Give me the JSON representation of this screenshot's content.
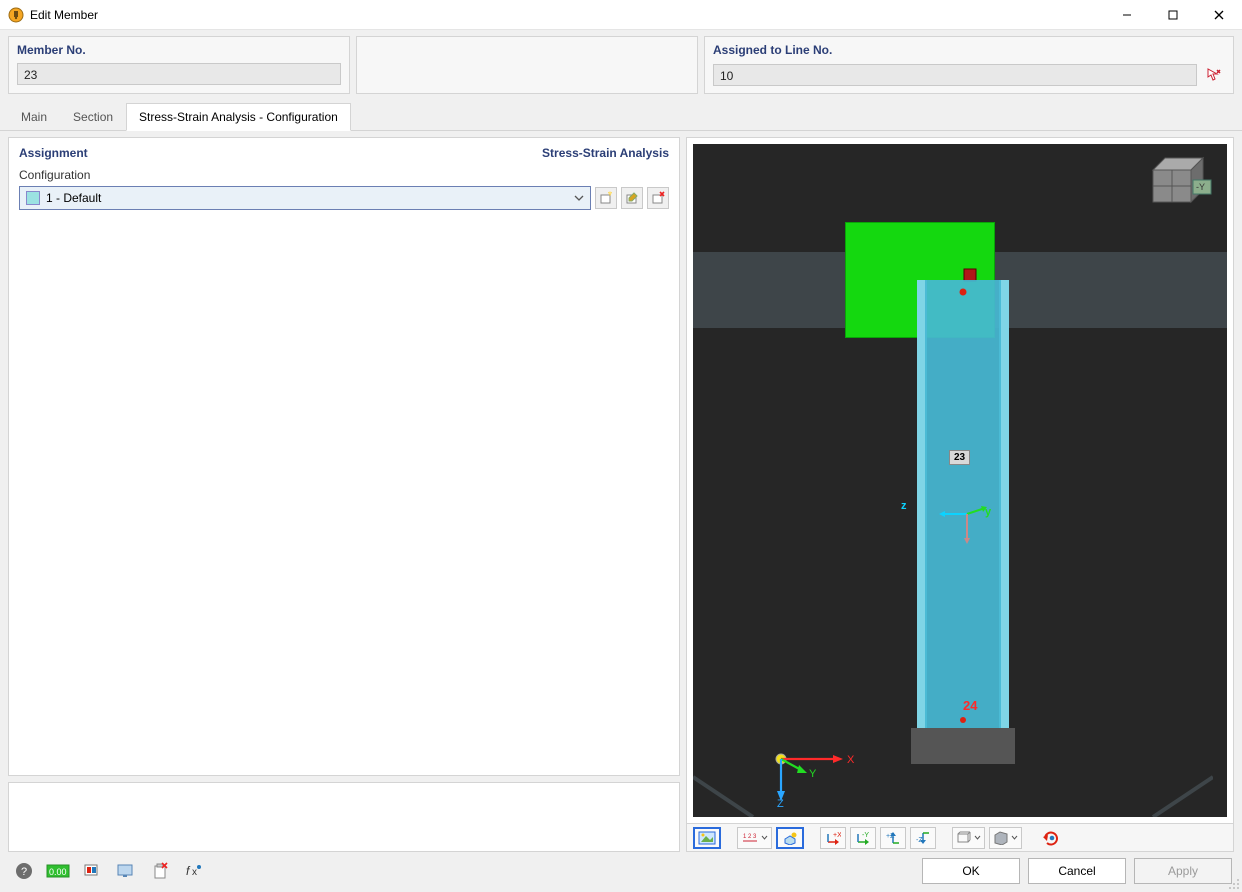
{
  "window": {
    "title": "Edit Member"
  },
  "info": {
    "member_label": "Member No.",
    "member_value": "23",
    "assigned_label": "Assigned to Line No.",
    "assigned_value": "10"
  },
  "tabs": [
    {
      "label": "Main"
    },
    {
      "label": "Section"
    },
    {
      "label": "Stress-Strain Analysis - Configuration"
    }
  ],
  "assignment": {
    "panel_title": "Assignment",
    "panel_title_right": "Stress-Strain Analysis",
    "config_label": "Configuration",
    "config_value": "1 - Default"
  },
  "view3d": {
    "member_badge": "23",
    "node_badge": "24",
    "axis_z": "z",
    "axis_y": "y",
    "ucs": {
      "x": "X",
      "y": "Y",
      "z": "Z"
    },
    "cube_y": "-Y"
  },
  "view_toolbar": {
    "btn_image": "image-view-icon",
    "btn_values": "show-values-icon",
    "btn_iso": "isometric-view-icon",
    "btn_x": "+X",
    "btn_y": "-Y",
    "btn_z_up": "+Z",
    "btn_z_dn": "-Z",
    "btn_wire": "wireframe-icon",
    "btn_solid": "solid-icon",
    "btn_reset": "reset-view-icon"
  },
  "bottom_tools": {
    "help": "help-icon",
    "units": "0.00",
    "display": "display-settings-icon",
    "screen": "screen-icon",
    "clip_off": "clipboard-x-icon",
    "fx": "fx-icon"
  },
  "buttons": {
    "ok": "OK",
    "cancel": "Cancel",
    "apply": "Apply"
  }
}
